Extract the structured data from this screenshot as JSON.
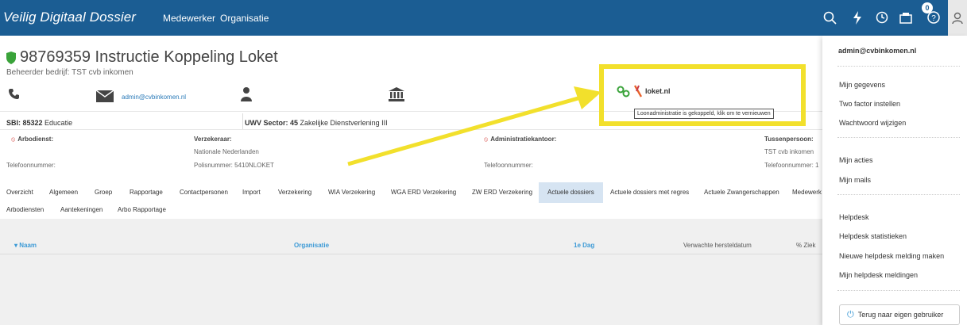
{
  "app": {
    "brand": "Veilig Digitaal Dossier",
    "nav": [
      "Medewerker",
      "Organisatie"
    ]
  },
  "toolbar": {
    "notification_count": "0"
  },
  "header": {
    "title": "98769359 Instructie Koppeling Loket",
    "subtitle": "Beheerder bedrijf: TST cvb inkomen",
    "email": "admin@cvbinkomen.nl",
    "sbi_label": "SBI: 85322",
    "sbi_value": "Educatie",
    "uwv_label": "UWV Sector: 45",
    "uwv_value": "Zakelijke Dienstverlening III"
  },
  "parties": {
    "arbodienst_label": "Arbodienst:",
    "arbodienst_phone": "Telefoonnummer:",
    "verzekeraar_label": "Verzekeraar:",
    "verzekeraar_name": "Nationale Nederlanden",
    "verzekeraar_polis": "Polisnummer: 5410NLOKET",
    "admin_label": "Administratiekantoor:",
    "admin_phone": "Telefoonnummer:",
    "tussen_label": "Tussenpersoon:",
    "tussen_name": "TST cvb inkomen",
    "tussen_phone": "Telefoonnummer: 1"
  },
  "loket": {
    "name": "loket.nl",
    "tooltip": "Loonadministratie is gekoppeld, klik om te vernieuwen"
  },
  "tabs_row1": [
    "Overzicht",
    "Algemeen",
    "Groep",
    "Rapportage",
    "Contactpersonen",
    "Import",
    "Verzekering",
    "WIA Verzekering",
    "WGA ERD Verzekering",
    "ZW ERD Verzekering",
    "Actuele dossiers",
    "Actuele dossiers met regres",
    "Actuele Zwangerschappen",
    "Medewerk"
  ],
  "tabs_row2": [
    "Arbodiensten",
    "Aantekeningen",
    "Arbo Rapportage"
  ],
  "table": {
    "columns": [
      "▾ Naam",
      "Organisatie",
      "1e Dag",
      "Verwachte hersteldatum",
      "% Ziek"
    ]
  },
  "user_menu": {
    "email": "admin@cvbinkomen.nl",
    "items_group1": [
      "Mijn gegevens",
      "Two factor instellen",
      "Wachtwoord wijzigen"
    ],
    "items_group2": [
      "Mijn acties",
      "Mijn mails"
    ],
    "items_group3": [
      "Helpdesk",
      "Helpdesk statistieken",
      "Nieuwe helpdesk melding maken",
      "Mijn helpdesk meldingen"
    ],
    "back_button": "Terug naar eigen gebruiker"
  },
  "colors": {
    "topbar": "#1b5d93",
    "highlight": "#f2e02c",
    "link": "#3c9ad6",
    "active_tab": "#d6e4f2"
  }
}
